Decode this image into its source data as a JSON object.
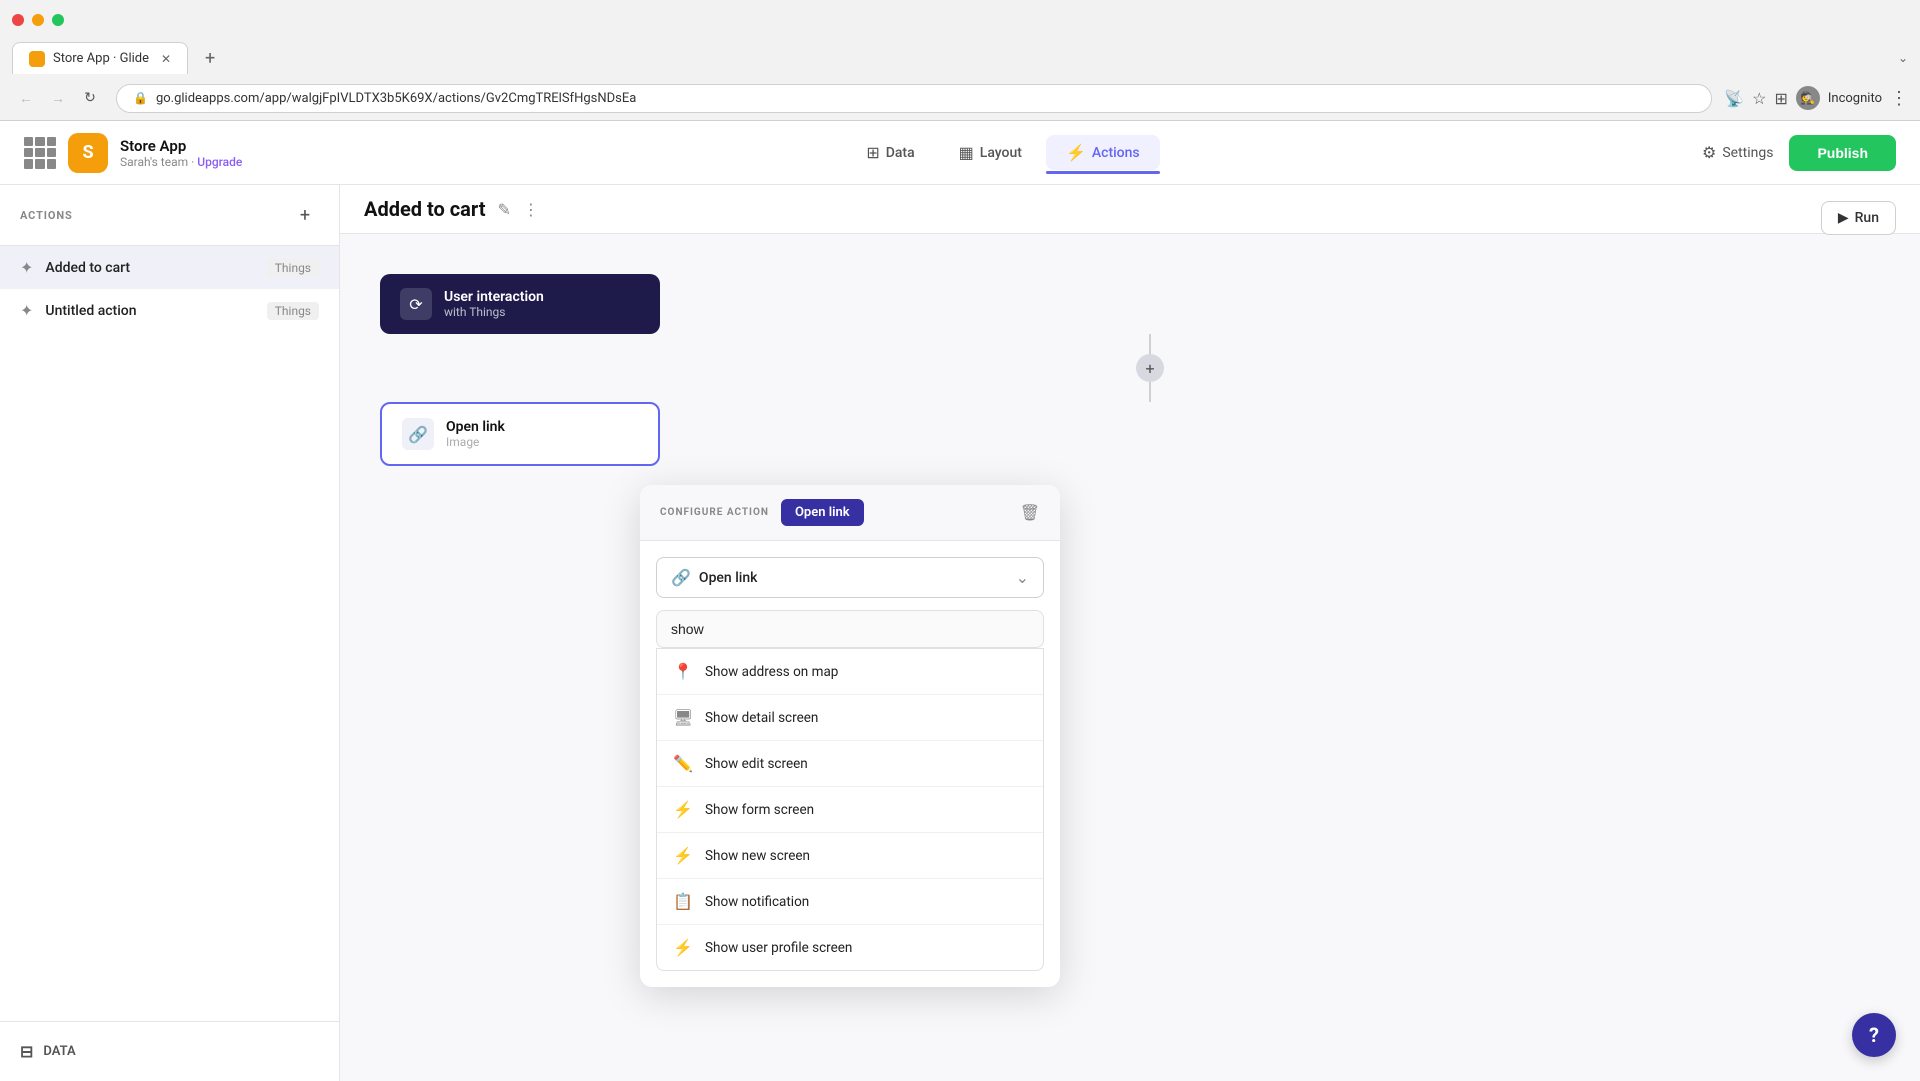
{
  "browser": {
    "tab_title": "Store App · Glide",
    "url": "go.glideapps.com/app/walgjFpIVLDTX3b5K69X/actions/Gv2CmgTRElSfHgsNDsEa",
    "incognito_label": "Incognito"
  },
  "app": {
    "name": "Store App",
    "team": "Sarah's team",
    "upgrade_label": "Upgrade"
  },
  "header": {
    "nav_data": "Data",
    "nav_layout": "Layout",
    "nav_actions": "Actions",
    "nav_settings": "Settings",
    "publish_label": "Publish",
    "run_label": "Run"
  },
  "sidebar": {
    "title": "ACTIONS",
    "items": [
      {
        "name": "Added to cart",
        "tag": "Things"
      },
      {
        "name": "Untitled action",
        "tag": "Things"
      }
    ],
    "data_nav_label": "DATA"
  },
  "canvas": {
    "title": "Added to cart",
    "flow_node_1_title": "User interaction",
    "flow_node_1_subtitle": "with Things",
    "flow_node_2_title": "Open link",
    "flow_node_2_subtitle": "Image"
  },
  "configure_panel": {
    "label": "CONFIGURE ACTION",
    "action_badge": "Open link",
    "action_dropdown_text": "Open link",
    "search_placeholder": "show",
    "search_value": "show",
    "dropdown_items": [
      {
        "icon": "📍",
        "label": "Show address on map",
        "icon_type": "map"
      },
      {
        "icon": "🖥",
        "label": "Show detail screen",
        "icon_type": "screen"
      },
      {
        "icon": "✏️",
        "label": "Show edit screen",
        "icon_type": "edit"
      },
      {
        "icon": "⚡",
        "label": "Show form screen",
        "icon_type": "form"
      },
      {
        "icon": "⚡",
        "label": "Show new screen",
        "icon_type": "new"
      },
      {
        "icon": "📋",
        "label": "Show notification",
        "icon_type": "notif"
      },
      {
        "icon": "⚡",
        "label": "Show user profile screen",
        "icon_type": "profile"
      }
    ]
  },
  "help_label": "?"
}
